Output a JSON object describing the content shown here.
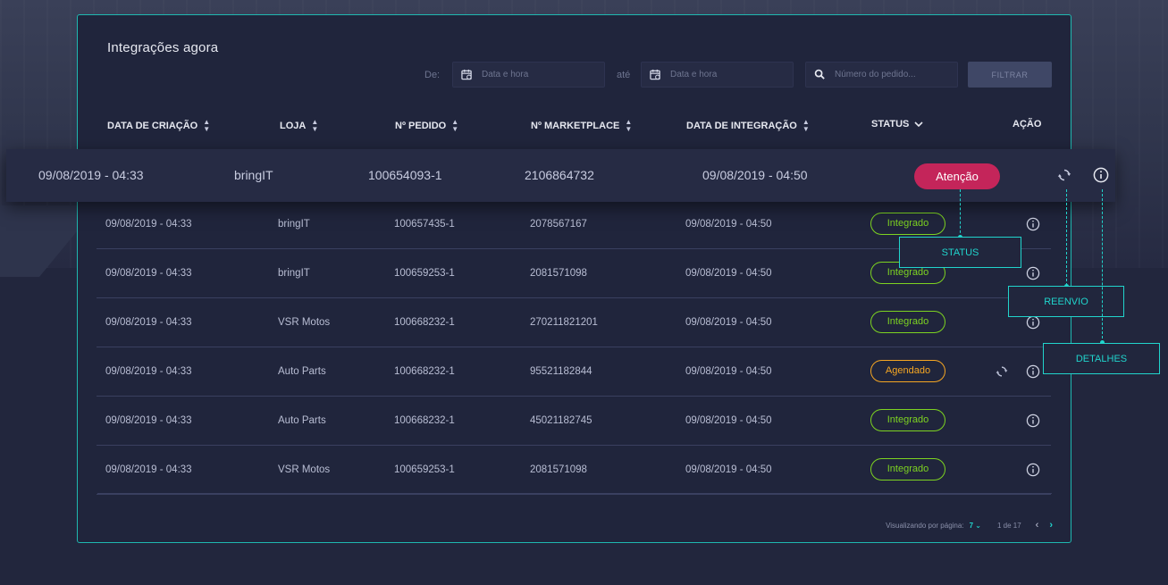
{
  "card": {
    "title": "Integrações agora"
  },
  "filters": {
    "from_label": "De:",
    "to_label": "até",
    "date_placeholder": "Data e hora",
    "search_placeholder": "Número do pedido...",
    "filter_button": "FILTRAR"
  },
  "columns": [
    "DATA DE CRIAÇÃO",
    "LOJA",
    "Nº PEDIDO",
    "Nº MARKETPLACE",
    "DATA DE INTEGRAÇÃO",
    "STATUS",
    "AÇÃO"
  ],
  "highlighted_row": {
    "created": "09/08/2019 - 04:33",
    "store": "bringIT",
    "order": "100654093-1",
    "marketplace": "2106864732",
    "integrated": "09/08/2019 - 04:50",
    "status": "Atenção"
  },
  "rows": [
    {
      "created": "09/08/2019 - 04:33",
      "store": "bringIT",
      "order": "100657435-1",
      "marketplace": "2078567167",
      "integrated": "09/08/2019 - 04:50",
      "status": "Integrado"
    },
    {
      "created": "09/08/2019 - 04:33",
      "store": "bringIT",
      "order": "100659253-1",
      "marketplace": "2081571098",
      "integrated": "09/08/2019 - 04:50",
      "status": "Integrado"
    },
    {
      "created": "09/08/2019 - 04:33",
      "store": "VSR Motos",
      "order": "100668232-1",
      "marketplace": "270211821201",
      "integrated": "09/08/2019 - 04:50",
      "status": "Integrado"
    },
    {
      "created": "09/08/2019 - 04:33",
      "store": "Auto Parts",
      "order": "100668232-1",
      "marketplace": "95521182844",
      "integrated": "09/08/2019 - 04:50",
      "status": "Agendado"
    },
    {
      "created": "09/08/2019 - 04:33",
      "store": "Auto Parts",
      "order": "100668232-1",
      "marketplace": "45021182745",
      "integrated": "09/08/2019 - 04:50",
      "status": "Integrado"
    },
    {
      "created": "09/08/2019 - 04:33",
      "store": "VSR Motos",
      "order": "100659253-1",
      "marketplace": "2081571098",
      "integrated": "09/08/2019 - 04:50",
      "status": "Integrado"
    }
  ],
  "pagination": {
    "per_page_label": "Visualizando por página:",
    "per_page_value": "7",
    "page_info": "1 de 17"
  },
  "callouts": {
    "status": "STATUS",
    "resend": "REENVIO",
    "details": "DETALHES"
  },
  "colors": {
    "accent": "#21d4cc",
    "integrado": "#7dd321",
    "agendado": "#f5a623",
    "atencao": "#c4255a"
  },
  "icons": [
    "calendar-icon",
    "search-icon",
    "sort-icon",
    "chevron-down-icon",
    "refresh-icon",
    "info-icon",
    "chevron-left-icon",
    "chevron-right-icon"
  ]
}
